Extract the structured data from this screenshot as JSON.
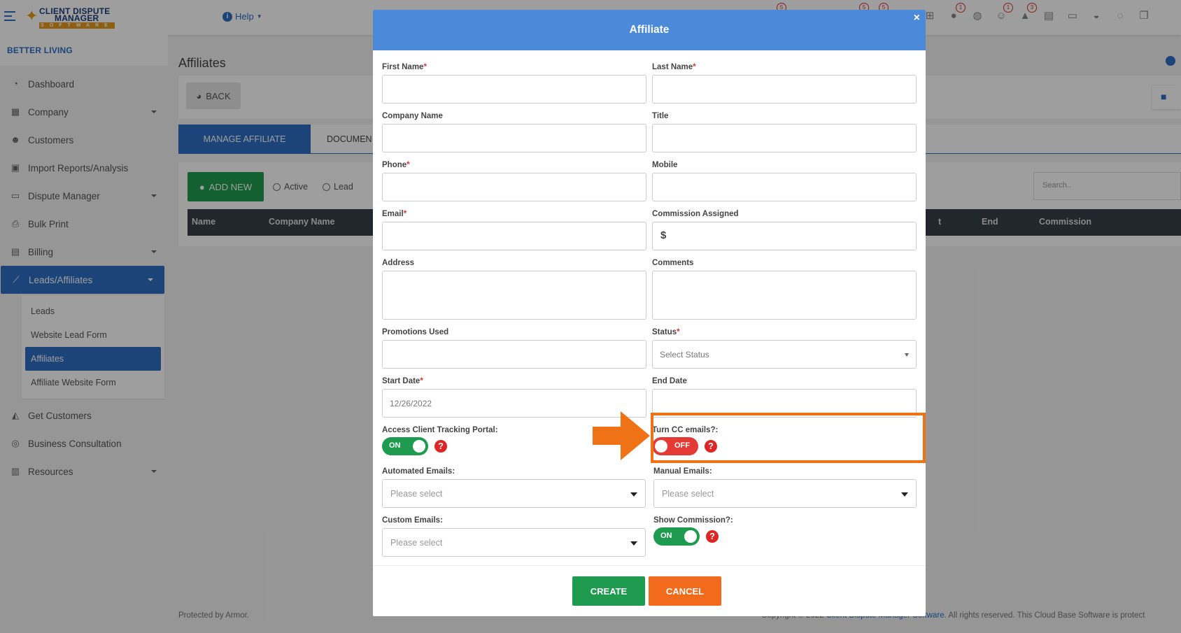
{
  "topbar": {
    "logo_line1": "CLIENT DISPUTE",
    "logo_line2": "MANAGER",
    "logo_line3": "SOFTWARE",
    "help_label": "Help",
    "badges": [
      "5",
      "5",
      "5",
      "1",
      "1",
      "3"
    ]
  },
  "sidebar": {
    "brand": "BETTER LIVING",
    "items": [
      {
        "label": "Dashboard",
        "icon": "pie-chart-icon"
      },
      {
        "label": "Company",
        "icon": "building-icon"
      },
      {
        "label": "Customers",
        "icon": "users-icon"
      },
      {
        "label": "Import Reports/Analysis",
        "icon": "file-import-icon"
      },
      {
        "label": "Dispute Manager",
        "icon": "laptop-icon"
      },
      {
        "label": "Bulk Print",
        "icon": "print-icon"
      },
      {
        "label": "Billing",
        "icon": "invoice-icon"
      },
      {
        "label": "Leads/Affiliates",
        "icon": "chart-line-icon"
      },
      {
        "label": "Get Customers",
        "icon": "graduation-cap-icon"
      },
      {
        "label": "Business Consultation",
        "icon": "headset-icon"
      },
      {
        "label": "Resources",
        "icon": "books-icon"
      }
    ],
    "subitems": [
      "Leads",
      "Website Lead Form",
      "Affiliates",
      "Affiliate Website Form"
    ]
  },
  "main": {
    "title": "Affiliates",
    "back_label": "BACK",
    "tabs": [
      "MANAGE AFFILIATE",
      "DOCUMEN"
    ],
    "add_new_label": "ADD NEW",
    "radios": [
      "Active",
      "Lead"
    ],
    "search_placeholder": "Search..",
    "columns": [
      "Name",
      "Company Name",
      "t",
      "End",
      "Commission"
    ],
    "footer_left": "Protected by Armor.",
    "footer_right_prefix": "Copyright © 2022 ",
    "footer_right_link": "Client Dispute Manager Software",
    "footer_right_suffix": ". All rights reserved. This Cloud Base Software is protect"
  },
  "modal": {
    "title": "Affiliate",
    "close": "×",
    "fields": {
      "first_name": "First Name",
      "last_name": "Last Name",
      "company_name": "Company Name",
      "title": "Title",
      "phone": "Phone",
      "mobile": "Mobile",
      "email": "Email",
      "commission": "Commission Assigned",
      "commission_prefix": "$",
      "address": "Address",
      "comments": "Comments",
      "promotions": "Promotions Used",
      "status": "Status",
      "status_placeholder": "Select Status",
      "start_date": "Start Date",
      "start_date_value": "12/26/2022",
      "end_date": "End Date",
      "access_portal": "Access Client Tracking Portal:",
      "turn_cc": "Turn CC emails?:",
      "automated_emails": "Automated Emails:",
      "manual_emails": "Manual Emails:",
      "custom_emails": "Custom Emails:",
      "show_commission": "Show Commission?:",
      "select_placeholder": "Please select"
    },
    "toggles": {
      "access_portal": "ON",
      "turn_cc": "OFF",
      "show_commission": "ON"
    },
    "required_mark": "*",
    "help_mark": "?",
    "create_label": "CREATE",
    "cancel_label": "CANCEL"
  },
  "colors": {
    "primary": "#2f6fc4",
    "modal_header": "#4a8ad8",
    "success": "#1f9b4f",
    "danger": "#e53935",
    "highlight": "#f07216"
  }
}
